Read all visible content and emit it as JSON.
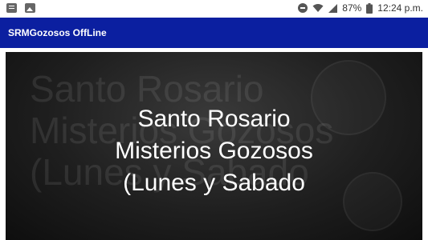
{
  "status_bar": {
    "battery_percent": "87%",
    "time": "12:24 p.m.",
    "icons": [
      "doc-notification-icon",
      "image-notification-icon",
      "do-not-disturb-icon",
      "wifi-icon",
      "signal-icon",
      "battery-icon"
    ]
  },
  "app_bar": {
    "title": "SRMGozosos OffLine",
    "color": "#0b1fa0"
  },
  "banner": {
    "line1": "Santo Rosario",
    "line2": "Misterios Gozosos",
    "line3": "(Lunes y Sabado",
    "ghost_line1": "Santo Rosario",
    "ghost_line2": "Misterios Gozosos",
    "ghost_line3": "(Lunes y Sabado"
  }
}
